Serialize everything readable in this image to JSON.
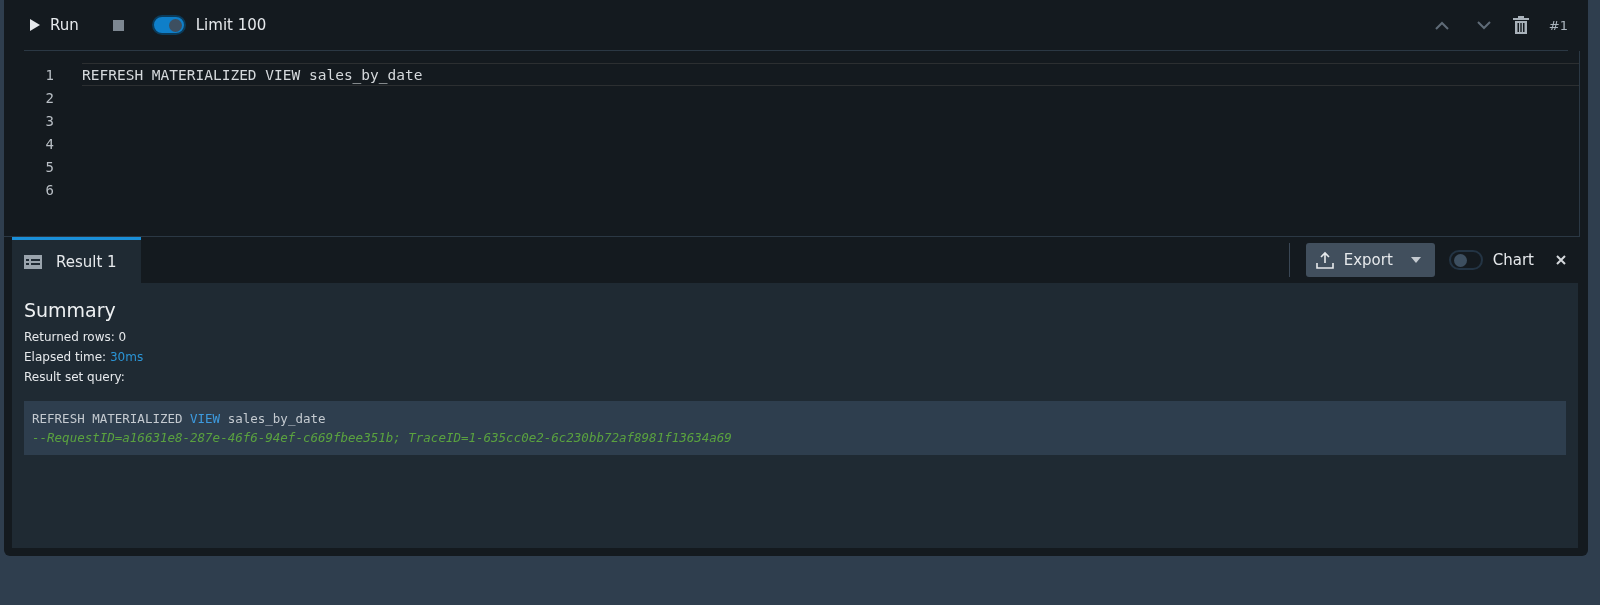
{
  "toolbar": {
    "run": "Run",
    "limit_toggle": {
      "label": "Limit 100",
      "on": true
    },
    "query_number": "#1"
  },
  "editor": {
    "lines": [
      {
        "number": "1",
        "text": "REFRESH MATERIALIZED VIEW sales_by_date",
        "selected": true
      },
      {
        "number": "2",
        "selected": false
      },
      {
        "number": "3",
        "selected": false
      },
      {
        "number": "4",
        "selected": false
      },
      {
        "number": "5",
        "selected": false
      },
      {
        "number": "6",
        "selected": false
      }
    ]
  },
  "results": {
    "tabs": [
      {
        "label": "Result 1",
        "selected": true
      }
    ],
    "export": "Export",
    "chart_toggle": {
      "label": "Chart",
      "on": false
    },
    "summary": {
      "title": "Summary",
      "rows": [
        {
          "label": "Returned rows: 0"
        },
        {
          "label": "Elapsed time: ",
          "value": "30ms"
        },
        {
          "label": "Result set query:"
        }
      ],
      "query": [
        [
          {
            "kind": "plain",
            "text": "REFRESH MATERIALIZED "
          },
          {
            "kind": "keyword",
            "text": "VIEW"
          },
          {
            "kind": "plain",
            "text": " sales_by_date"
          }
        ],
        [
          {
            "kind": "comment",
            "text": "--RequestID=a16631e8-287e-46f6-94ef-c669fbee351b; TraceID=1-635cc0e2-6c230bb72af8981f13634a69"
          }
        ]
      ]
    }
  }
}
